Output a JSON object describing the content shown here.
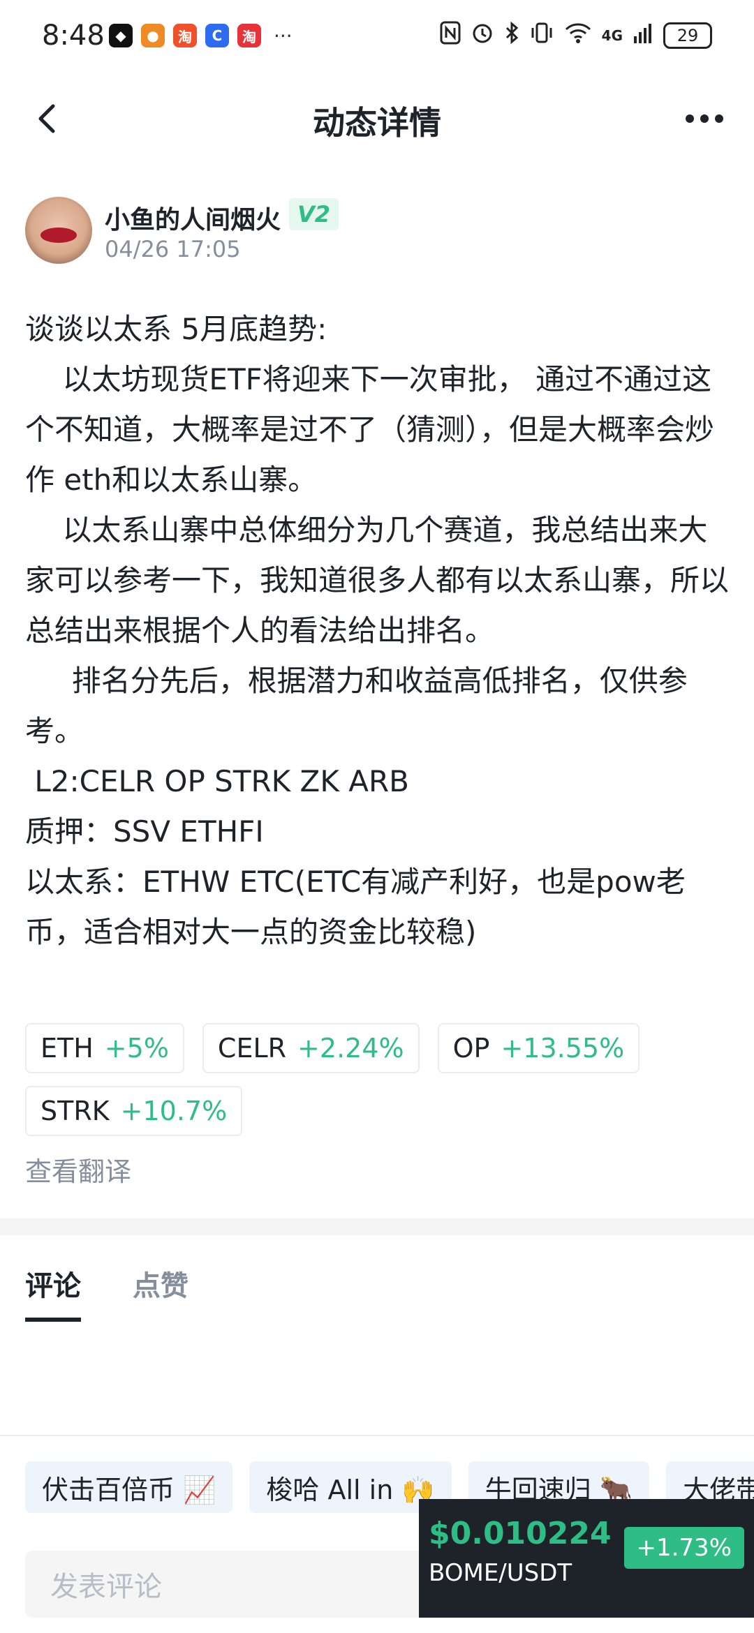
{
  "status_bar": {
    "time": "8:48",
    "apps": [
      {
        "icon": "binance-app-icon",
        "glyph": "◆",
        "color": "#111111"
      },
      {
        "icon": "chat-app-icon",
        "glyph": "●",
        "color": "#f08a24"
      },
      {
        "icon": "taobao-special-app-icon",
        "glyph": "淘",
        "color": "#f0502a"
      },
      {
        "icon": "c-app-icon",
        "glyph": "C",
        "color": "#2d6cf0"
      },
      {
        "icon": "taobao-app-icon",
        "glyph": "淘",
        "color": "#e8323a"
      }
    ],
    "more": "···",
    "network": "4G",
    "battery": "29"
  },
  "header": {
    "title": "动态详情"
  },
  "author": {
    "name": "小鱼的人间烟火",
    "badge": "V2",
    "time": "04/26 17:05"
  },
  "post": {
    "paragraphs": [
      "谈谈以太系 5月底趋势:",
      "    以太坊现货ETF将迎来下一次审批， 通过不通过这个不知道，大概率是过不了（猜测），但是大概率会炒作 eth和以太系山寨。",
      "    以太系山寨中总体细分为几个赛道，我总结出来大家可以参考一下，我知道很多人都有以太系山寨，所以总结出来根据个人的看法给出排名。",
      "     排名分先后，根据潜力和收益高低排名，仅供参考。",
      " L2:CELR OP STRK ZK ARB",
      "质押：SSV ETHFI",
      "以太系：ETHW ETC(ETC有减产利好，也是pow老币，适合相对大一点的资金比较稳)"
    ]
  },
  "coins": [
    {
      "symbol": "ETH",
      "change": "+5%"
    },
    {
      "symbol": "CELR",
      "change": "+2.24%"
    },
    {
      "symbol": "OP",
      "change": "+13.55%"
    },
    {
      "symbol": "STRK",
      "change": "+10.7%"
    }
  ],
  "translate_label": "查看翻译",
  "tabs": [
    {
      "label": "评论",
      "active": true
    },
    {
      "label": "点赞",
      "active": false
    }
  ],
  "quick_chips": [
    "伏击百倍币 📈",
    "梭哈 All in 🙌",
    "牛回速归 🐂",
    "大佬带"
  ],
  "comment_input": {
    "placeholder": "发表评论"
  },
  "ticker": {
    "price": "$0.010224",
    "pair": "BOME/USDT",
    "change": "+1.73%"
  },
  "colors": {
    "up_green": "#2ebd85",
    "text_primary": "#1e2329",
    "text_secondary": "#848e9c"
  }
}
